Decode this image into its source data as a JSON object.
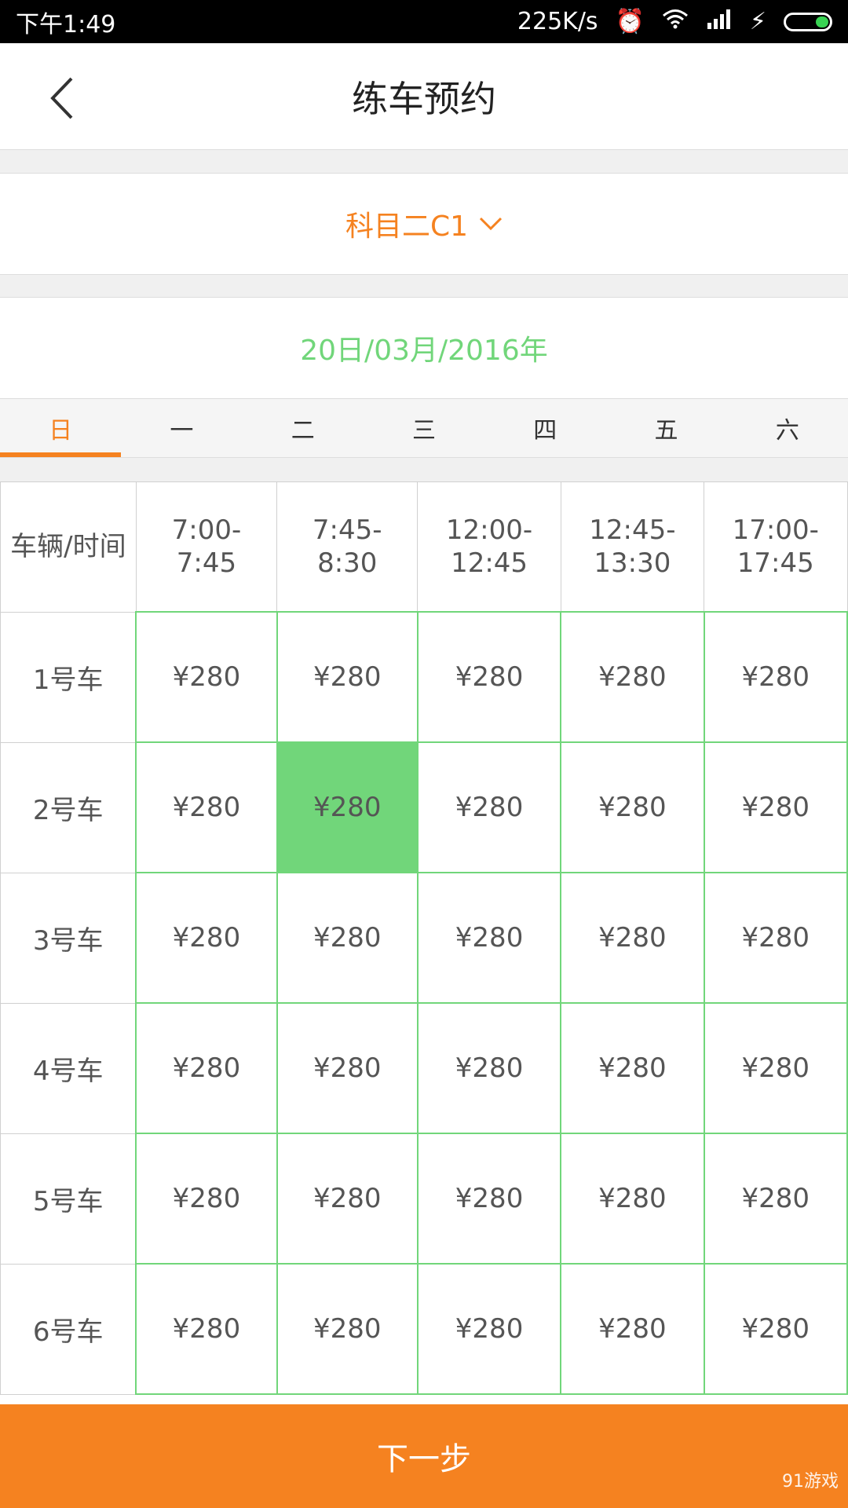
{
  "status": {
    "time": "下午1:49",
    "speed": "225K/s"
  },
  "header": {
    "title": "练车预约"
  },
  "subject": {
    "label": "科目二C1"
  },
  "date": {
    "label": "20日/03月/2016年"
  },
  "weekdays": [
    "日",
    "一",
    "二",
    "三",
    "四",
    "五",
    "六"
  ],
  "table": {
    "corner": "车辆/时间",
    "times": [
      "7:00-\n7:45",
      "7:45-\n8:30",
      "12:00-\n12:45",
      "12:45-\n13:30",
      "17:00-\n17:45"
    ],
    "cars": [
      "1号车",
      "2号车",
      "3号车",
      "4号车",
      "5号车",
      "6号车"
    ],
    "price": "¥280"
  },
  "footer": {
    "next": "下一步"
  },
  "watermark": "91游戏",
  "colors": {
    "accent": "#f58220",
    "green": "#71d67a"
  }
}
